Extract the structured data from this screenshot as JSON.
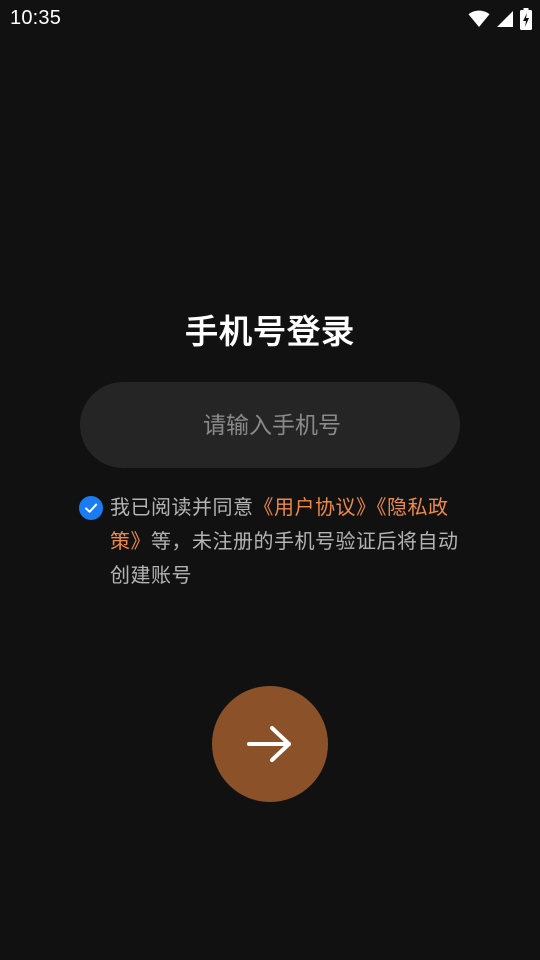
{
  "status_bar": {
    "time": "10:35",
    "icons": [
      "wifi-icon",
      "cellular-signal-icon",
      "battery-charging-icon"
    ]
  },
  "login": {
    "title": "手机号登录",
    "phone_input": {
      "value": "",
      "placeholder": "请输入手机号"
    },
    "agreement": {
      "checked": true,
      "prefix": "我已阅读并同意",
      "user_agreement_link": "《用户协议》",
      "privacy_policy_link": "《隐私政策》",
      "suffix": "等，未注册的手机号验证后将自动创建账号"
    },
    "next_button": {
      "icon": "arrow-right-icon"
    }
  },
  "colors": {
    "background": "#111111",
    "input_background": "#252525",
    "link": "#ec8a48",
    "checkbox": "#1b7cf2",
    "next_button": "#8b5229"
  }
}
